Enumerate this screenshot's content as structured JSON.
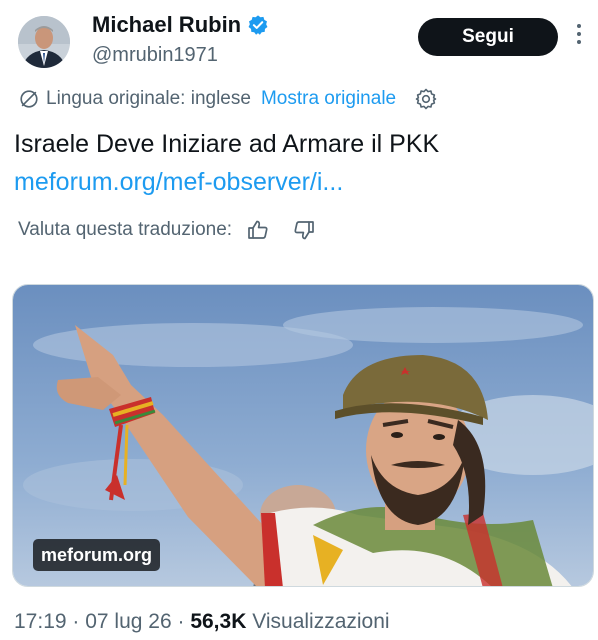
{
  "author": {
    "display_name": "Michael Rubin",
    "handle": "@mrubin1971",
    "verified": true,
    "follow_label": "Segui"
  },
  "translation": {
    "language_note": "Lingua originale: inglese",
    "show_original_label": "Mostra originale",
    "rate_prompt": "Valuta questa traduzione:"
  },
  "tweet": {
    "text": "Israele Deve Iniziare ad Armare il PKK",
    "link": "meforum.org/mef-observer/i..."
  },
  "media": {
    "source_label": "meforum.org"
  },
  "meta": {
    "time": "17:19",
    "date": "07 lug 26",
    "view_count": "56,3K",
    "view_label": "Visualizzazioni"
  },
  "colors": {
    "accent": "#1d9bf0",
    "text_primary": "#0f1419",
    "text_secondary": "#536471",
    "follow_bg": "#0f1419"
  },
  "icons": {
    "verified": "verified-badge-icon",
    "translate": "globe-slash-icon",
    "settings": "gear-icon",
    "thumbs_up": "thumbs-up-icon",
    "thumbs_down": "thumbs-down-icon",
    "more": "more-vertical-icon"
  }
}
